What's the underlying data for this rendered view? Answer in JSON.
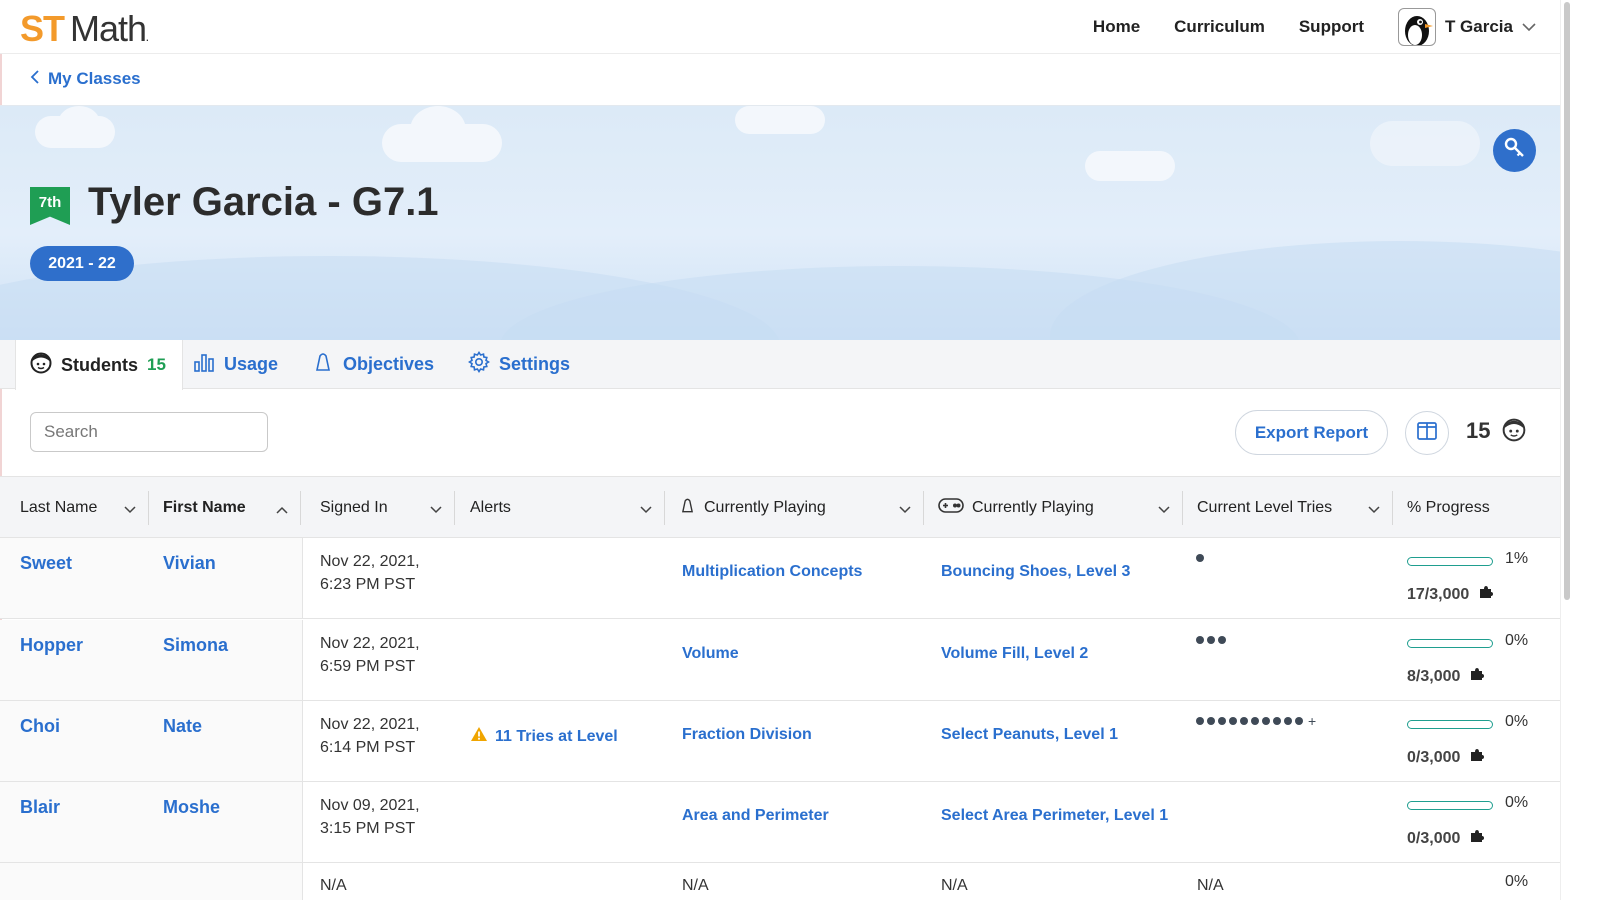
{
  "brand": {
    "st": "ST",
    "math": "Math",
    "tm": "."
  },
  "nav": {
    "links": [
      "Home",
      "Curriculum",
      "Support"
    ],
    "user_name": "T Garcia"
  },
  "breadcrumb": {
    "label": "My Classes"
  },
  "class_header": {
    "grade": "7th",
    "title": "Tyler Garcia - G7.1",
    "year": "2021 - 22"
  },
  "tabs": {
    "students": {
      "label": "Students",
      "count": "15"
    },
    "usage": "Usage",
    "objectives": "Objectives",
    "settings": "Settings"
  },
  "toolbar": {
    "search_placeholder": "Search",
    "export_label": "Export Report",
    "student_count": "15"
  },
  "table": {
    "columns": [
      "Last Name",
      "First Name",
      "Signed In",
      "Alerts",
      "Currently Playing",
      "Currently Playing",
      "Current Level Tries",
      "% Progress"
    ],
    "rows": [
      {
        "last": "Sweet",
        "first": "Vivian",
        "signed_line1": "Nov 22, 2021,",
        "signed_line2": "6:23 PM PST",
        "alert": "",
        "objective": "Multiplication Concepts",
        "game": "Bouncing Shoes, Level 3",
        "tries": 1,
        "tries_plus": false,
        "progress_pct": "1%",
        "progress_fraction": 0.01,
        "puzzles": "17/3,000"
      },
      {
        "last": "Hopper",
        "first": "Simona",
        "signed_line1": "Nov 22, 2021,",
        "signed_line2": "6:59 PM PST",
        "alert": "",
        "objective": "Volume",
        "game": "Volume Fill, Level 2",
        "tries": 3,
        "tries_plus": false,
        "progress_pct": "0%",
        "progress_fraction": 0.0,
        "puzzles": "8/3,000"
      },
      {
        "last": "Choi",
        "first": "Nate",
        "signed_line1": "Nov 22, 2021,",
        "signed_line2": "6:14 PM PST",
        "alert": "11 Tries at Level",
        "objective": "Fraction Division",
        "game": "Select Peanuts, Level 1",
        "tries": 10,
        "tries_plus": true,
        "progress_pct": "0%",
        "progress_fraction": 0.0,
        "puzzles": "0/3,000"
      },
      {
        "last": "Blair",
        "first": "Moshe",
        "signed_line1": "Nov 09, 2021,",
        "signed_line2": "3:15 PM PST",
        "alert": "",
        "objective": "Area and Perimeter",
        "game": "Select Area Perimeter, Level 1",
        "tries": 0,
        "tries_plus": false,
        "progress_pct": "0%",
        "progress_fraction": 0.0,
        "puzzles": "0/3,000"
      }
    ],
    "partial_row": {
      "signed": "N/A",
      "objective": "N/A",
      "game": "N/A",
      "tries": "N/A",
      "progress_pct": "0%"
    }
  },
  "colors": {
    "brand_orange": "#f39a2b",
    "link_blue": "#2a6fce",
    "grade_green": "#1f9e54",
    "pill_blue": "#2f6fcb",
    "progress_teal": "#1f9e8f",
    "alert_amber": "#f0a500"
  }
}
